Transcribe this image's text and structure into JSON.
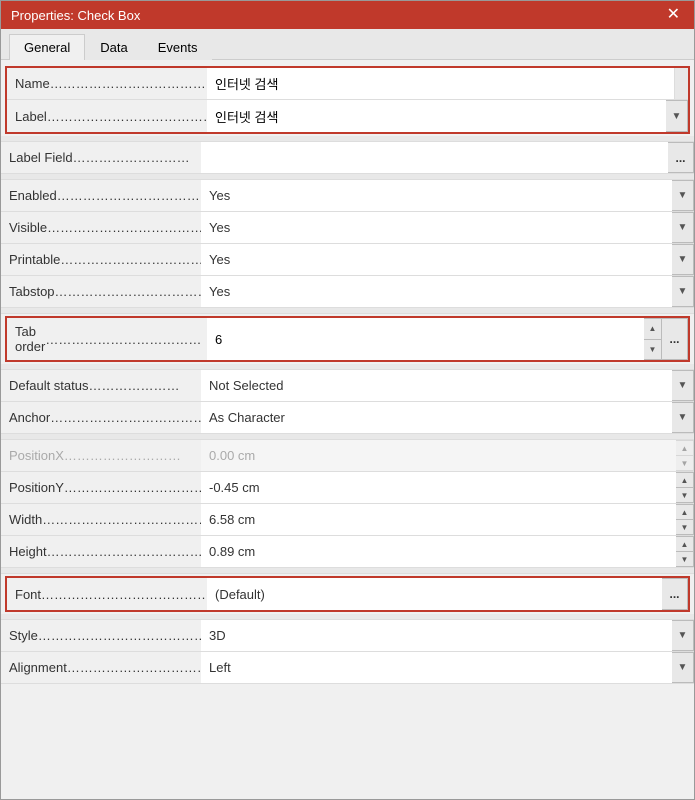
{
  "window": {
    "title": "Properties: Check Box",
    "close_label": "✕"
  },
  "tabs": [
    {
      "label": "General",
      "active": true
    },
    {
      "label": "Data",
      "active": false
    },
    {
      "label": "Events",
      "active": false
    }
  ],
  "properties": {
    "name_label": "Name",
    "name_value": "인터넷 검색",
    "label_label": "Label",
    "label_value": "인터넷 검색",
    "label_field_label": "Label Field",
    "label_field_value": "",
    "enabled_label": "Enabled",
    "enabled_value": "Yes",
    "visible_label": "Visible",
    "visible_value": "Yes",
    "printable_label": "Printable",
    "printable_value": "Yes",
    "tabstop_label": "Tabstop",
    "tabstop_value": "Yes",
    "tab_order_label": "Tab order",
    "tab_order_value": "6",
    "default_status_label": "Default status",
    "default_status_value": "Not Selected",
    "anchor_label": "Anchor",
    "anchor_value": "As Character",
    "positionx_label": "PositionX",
    "positionx_value": "0.00 cm",
    "positiony_label": "PositionY",
    "positiony_value": "-0.45 cm",
    "width_label": "Width",
    "width_value": "6.58 cm",
    "height_label": "Height",
    "height_value": "0.89 cm",
    "font_label": "Font",
    "font_value": "(Default)",
    "style_label": "Style",
    "style_value": "3D",
    "alignment_label": "Alignment",
    "alignment_value": "Left",
    "ellipsis": "...",
    "dropdown_arrow": "▼",
    "spinner_up": "▲",
    "spinner_down": "▼"
  }
}
